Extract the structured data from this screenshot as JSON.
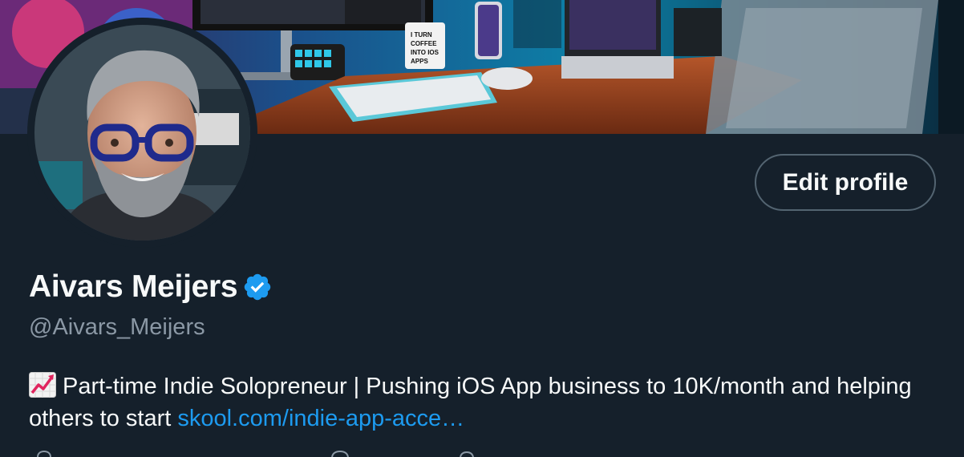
{
  "profile": {
    "display_name": "Aivars Meijers",
    "handle": "@Aivars_Meijers",
    "verified": true,
    "edit_button_label": "Edit profile",
    "bio_emoji": "chart-increasing-icon",
    "bio_text": "Part-time Indie Solopreneur | Pushing iOS App business to 10K/month and helping others to start ",
    "bio_link": "skool.com/indie-app-acce…"
  },
  "banner": {
    "mug_text": "I TURN COFFEE INTO IOS APPS"
  },
  "colors": {
    "background": "#15202b",
    "primary_text": "#f7f9f9",
    "secondary_text": "#8b98a5",
    "accent": "#1d9bf0",
    "button_border": "#536471"
  }
}
